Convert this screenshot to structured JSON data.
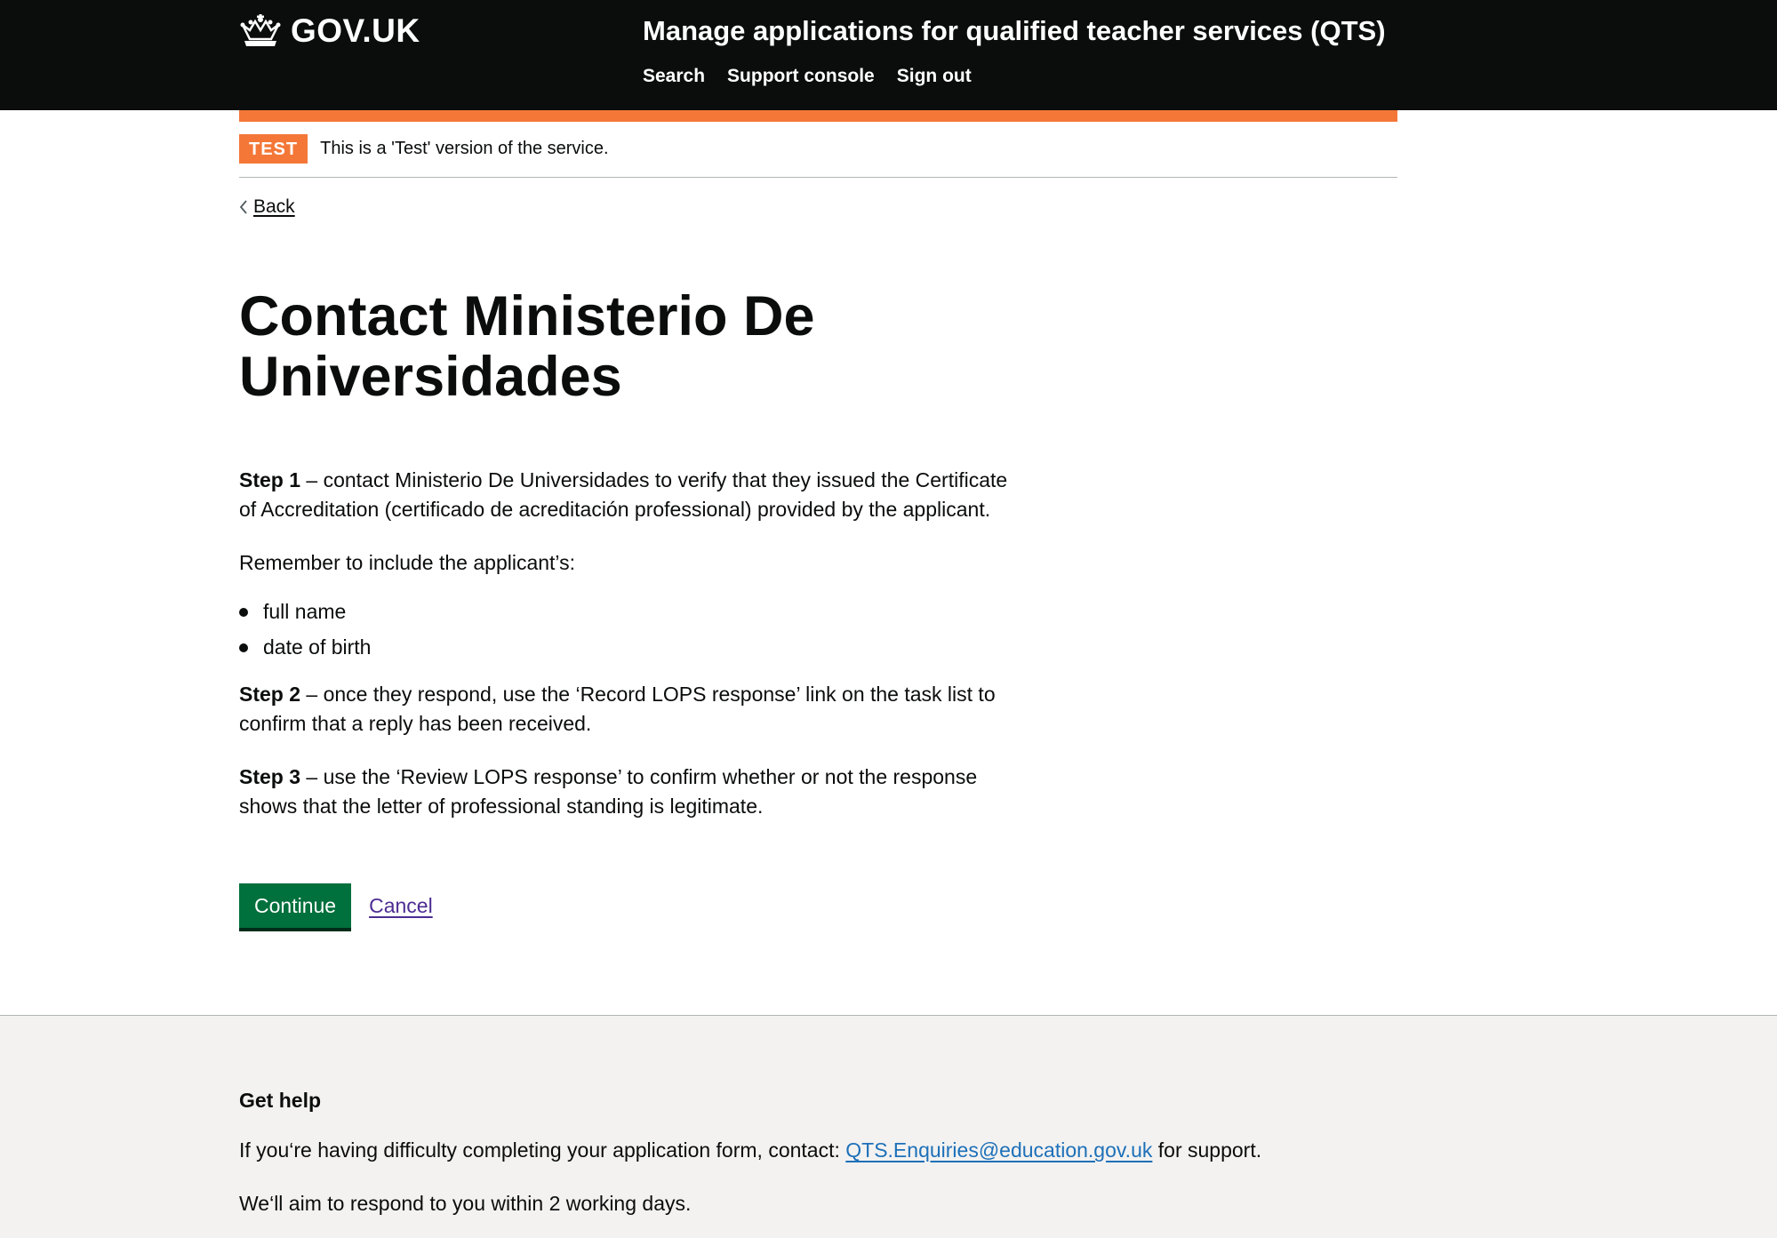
{
  "header": {
    "logo_text": "GOV.UK",
    "service_name": "Manage applications for qualified teacher services (QTS)",
    "nav": [
      "Search",
      "Support console",
      "Sign out"
    ]
  },
  "phase_banner": {
    "tag": "TEST",
    "text": "This is a 'Test' version of the service."
  },
  "back_link": "Back",
  "page_title": "Contact Ministerio De Universidades",
  "steps": {
    "step1_label": "Step 1",
    "step1_text": " – contact Ministerio De Universidades to verify that they issued the Certificate of Accreditation (certificado de acreditación professional) provided by the applicant.",
    "remember_text": "Remember to include the applicant’s:",
    "bullets": [
      "full name",
      "date of birth"
    ],
    "step2_label": "Step 2",
    "step2_text": " – once they respond, use the ‘Record LOPS response’ link on the task list to confirm that a reply has been received.",
    "step3_label": "Step 3",
    "step3_text": " – use the ‘Review LOPS response’ to confirm whether or not the response shows that the letter of professional standing is legitimate."
  },
  "actions": {
    "continue_label": "Continue",
    "cancel_label": "Cancel"
  },
  "footer": {
    "heading": "Get help",
    "help_prefix": "If you‘re having difficulty completing your application form, contact: ",
    "email": "QTS.Enquiries@education.gov.uk",
    "help_suffix": " for support.",
    "respond_text": "We‘ll aim to respond to you within 2 working days."
  },
  "colors": {
    "header_bg": "#0b0c0c",
    "phase_orange": "#f47738",
    "button_green": "#00703c",
    "link_blue": "#1d70b8",
    "visited_purple": "#4c2c92",
    "footer_bg": "#f3f2f1"
  }
}
